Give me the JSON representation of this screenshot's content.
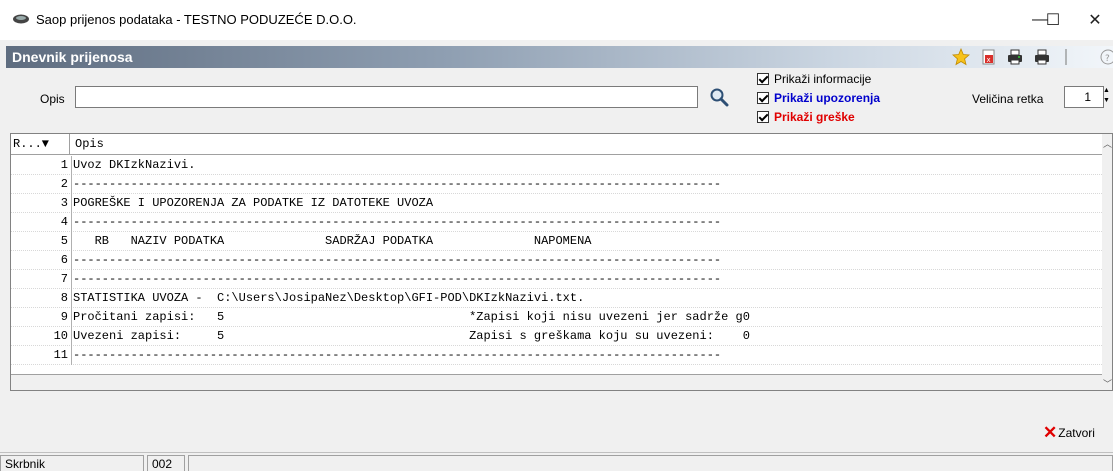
{
  "window": {
    "title": "Saop prijenos podataka - TESTNO PODUZEĆE D.O.O.",
    "minimize_glyph": "—",
    "maximize_glyph": "☐",
    "close_glyph": "✕"
  },
  "header": {
    "title": "Dnevnik prijenosa",
    "toolbar_icons": [
      "star-icon",
      "export-icon",
      "print-icon",
      "print-setup-icon",
      "help-icon"
    ]
  },
  "filter": {
    "opis_label": "Opis",
    "opis_value": "",
    "show_info_label": "Prikaži informacije",
    "show_warnings_label": "Prikaži upozorenja",
    "show_errors_label": "Prikaži greške",
    "row_size_label": "Veličina retka",
    "row_size_value": "1"
  },
  "grid": {
    "col_rownum": "R...▼",
    "col_opis": "Opis",
    "rows": [
      {
        "num": "1",
        "text": "Uvoz DKIzkNazivi."
      },
      {
        "num": "2",
        "text": "------------------------------------------------------------------------------------------"
      },
      {
        "num": "3",
        "text": "POGREŠKE I UPOZORENJA ZA PODATKE IZ DATOTEKE UVOZA"
      },
      {
        "num": "4",
        "text": "------------------------------------------------------------------------------------------"
      },
      {
        "num": "5",
        "text": "   RB   NAZIV PODATKA              SADRŽAJ PODATKA              NAPOMENA"
      },
      {
        "num": "6",
        "text": "------------------------------------------------------------------------------------------"
      },
      {
        "num": "7",
        "text": "------------------------------------------------------------------------------------------"
      },
      {
        "num": "8",
        "text": "STATISTIKA UVOZA -  C:\\Users\\JosipaNez\\Desktop\\GFI-POD\\DKIzkNazivi.txt."
      },
      {
        "num": "9",
        "text": "Pročitani zapisi:   5                                  *Zapisi koji nisu uvezeni jer sadrže g0"
      },
      {
        "num": "10",
        "text": "Uvezeni zapisi:     5                                  Zapisi s greškama koju su uvezeni:    0"
      },
      {
        "num": "11",
        "text": "------------------------------------------------------------------------------------------"
      }
    ]
  },
  "actions": {
    "close_label": "Zatvori"
  },
  "status": {
    "user": "Skrbnik",
    "code": "002",
    "rest": ""
  },
  "colors": {
    "warning_text": "#0000cc",
    "error_text": "#e00000",
    "header_gradient_start": "#5f6d80",
    "header_gradient_end": "#f2f6fa"
  }
}
